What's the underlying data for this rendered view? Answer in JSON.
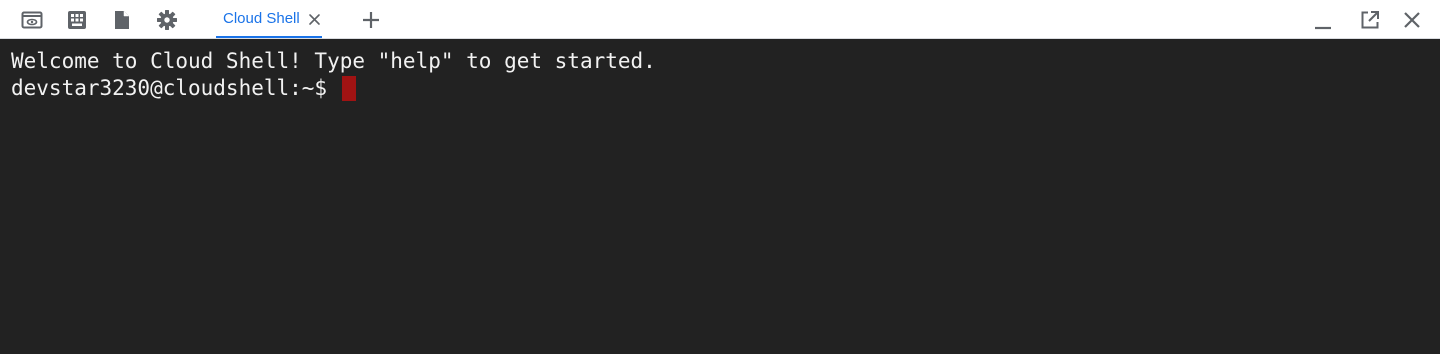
{
  "toolbar": {
    "icons": {
      "preview": "web-preview-icon",
      "keyboard": "keyboard-icon",
      "file": "file-icon",
      "settings": "gear-icon",
      "new_tab": "add-tab-icon",
      "minimize": "minimize-icon",
      "open_new_window": "open-in-new-window-icon",
      "close": "close-icon"
    },
    "icon_color": "#5f6368",
    "accent_color": "#1a73e8"
  },
  "tabs": [
    {
      "label": "Cloud Shell",
      "active": true
    }
  ],
  "terminal": {
    "lines": [
      "Welcome to Cloud Shell! Type \"help\" to get started.",
      "devstar3230@cloudshell:~$"
    ],
    "background": "#222222",
    "text_color": "#f2f2f2",
    "cursor_color": "#a01313"
  }
}
